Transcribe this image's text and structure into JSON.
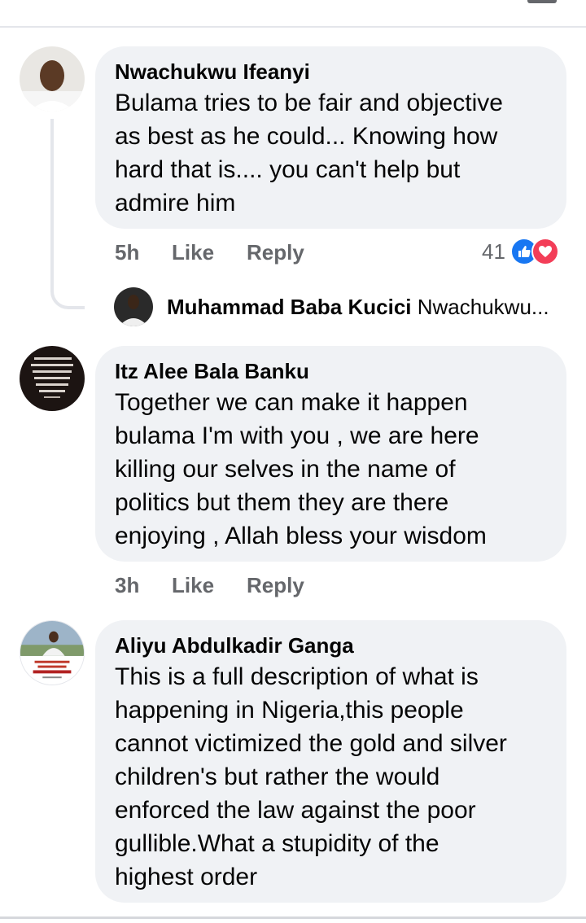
{
  "comments": [
    {
      "author": "Nwachukwu Ifeanyi",
      "text": [
        "Bulama tries to be fair and objective",
        "as best as he could... Knowing how",
        "hard that is.... you can't help but",
        "admire him"
      ],
      "time": "5h",
      "like_label": "Like",
      "reply_label": "Reply",
      "reaction_count": "41",
      "reactions": [
        "like-icon",
        "love-icon"
      ],
      "reply_preview": {
        "author": "Muhammad Baba Kucici",
        "snippet": "Nwachukwu..."
      }
    },
    {
      "author": "Itz Alee Bala Banku",
      "text": [
        "Together we can make it happen",
        "bulama I'm with you , we are here",
        "killing our selves in the name of",
        "politics but them they are there",
        "enjoying , Allah bless your wisdom"
      ],
      "time": "3h",
      "like_label": "Like",
      "reply_label": "Reply"
    },
    {
      "author": "Aliyu Abdulkadir Ganga",
      "text": [
        "This is a full description of what is",
        "happening in Nigeria,this people",
        "cannot victimized the gold and silver",
        "children's but rather the would",
        "enforced the law against the poor",
        "gullible.What a stupidity of the",
        "highest order"
      ]
    }
  ],
  "colors": {
    "bubble": "#f0f2f5",
    "meta": "#65676b",
    "like_blue": "#1877f2",
    "love_red": "#f33e58"
  }
}
